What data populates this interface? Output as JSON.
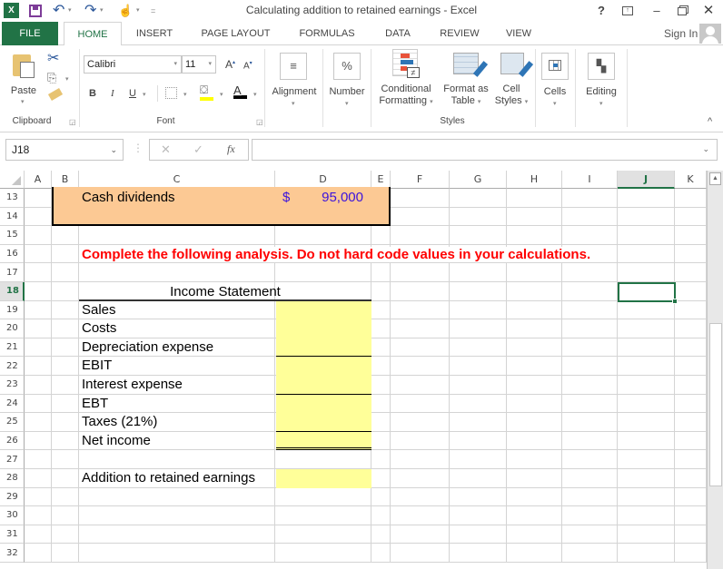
{
  "window": {
    "title": "Calculating addition to retained earnings - Excel",
    "help": "?",
    "ribbon_display": "⊼",
    "minimize": "–",
    "restore": "🗗",
    "close": "✕"
  },
  "qat": {
    "app_icon": "X",
    "save_icon": "💾",
    "undo_icon": "↶",
    "redo_icon": "↷",
    "touch_icon": "☝",
    "customize_icon": "="
  },
  "tabs": [
    {
      "label": "FILE"
    },
    {
      "label": "HOME"
    },
    {
      "label": "INSERT"
    },
    {
      "label": "PAGE LAYOUT"
    },
    {
      "label": "FORMULAS"
    },
    {
      "label": "DATA"
    },
    {
      "label": "REVIEW"
    },
    {
      "label": "VIEW"
    }
  ],
  "account": {
    "sign_in": "Sign In"
  },
  "ribbon": {
    "clipboard": {
      "paste": "Paste",
      "label": "Clipboard"
    },
    "font": {
      "name": "Calibri",
      "size": "11",
      "bold": "B",
      "italic": "I",
      "underline": "U",
      "grow": "A",
      "shrink": "A",
      "font_color": "A",
      "label": "Font",
      "fill_color": "#ffff00",
      "text_color": "#000000"
    },
    "alignment": {
      "label": "Alignment"
    },
    "number": {
      "label": "Number",
      "icon": "%"
    },
    "styles": {
      "conditional": "Conditional",
      "conditional2": "Formatting",
      "format_as": "Format as",
      "format_as2": "Table",
      "cell_styles": "Cell",
      "cell_styles2": "Styles",
      "label": "Styles"
    },
    "cells": {
      "label": "Cells"
    },
    "editing": {
      "label": "Editing"
    },
    "collapse": "^"
  },
  "formula_bar": {
    "name_box": "J18",
    "cancel": "✕",
    "enter": "✓",
    "fx": "fx",
    "value": ""
  },
  "sheet": {
    "columns": [
      "A",
      "B",
      "C",
      "D",
      "E",
      "F",
      "G",
      "H",
      "I",
      "J",
      "K"
    ],
    "selected_column": "J",
    "selected_row": "18",
    "rows": [
      "13",
      "14",
      "15",
      "16",
      "17",
      "18",
      "19",
      "20",
      "21",
      "22",
      "23",
      "24",
      "25",
      "26",
      "27",
      "28",
      "29",
      "30",
      "31",
      "32"
    ],
    "cash_dividends": {
      "label": "Cash dividends",
      "currency": "$",
      "value": "95,000"
    },
    "instruction": "Complete the following analysis. Do not hard code values in your calculations.",
    "income_statement": {
      "title": "Income Statement",
      "lines": [
        "Sales",
        "Costs",
        "Depreciation expense",
        "EBIT",
        "Interest expense",
        "EBT",
        "Taxes (21%)",
        "Net income"
      ],
      "addition_label": "Addition to retained earnings"
    },
    "colors": {
      "input_box": "#fcc994",
      "answer_fill": "#ffff99",
      "instruction_text": "#ff0000",
      "value_text": "#3c14dc",
      "selection": "#217346"
    }
  }
}
